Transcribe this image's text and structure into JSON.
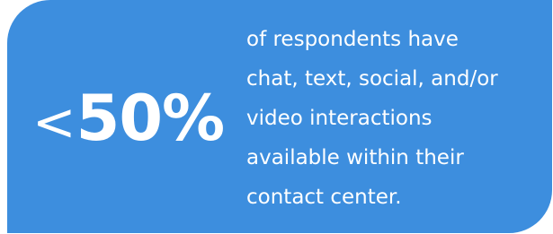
{
  "stat": {
    "prefix": "<",
    "value": "50%",
    "description_lines": [
      "of respondents have",
      "chat, text, social, and/or",
      "video interactions",
      "available within their",
      "contact center."
    ]
  },
  "colors": {
    "card_background": "#3d8ede",
    "text": "#ffffff",
    "page_background": "#ffffff"
  }
}
